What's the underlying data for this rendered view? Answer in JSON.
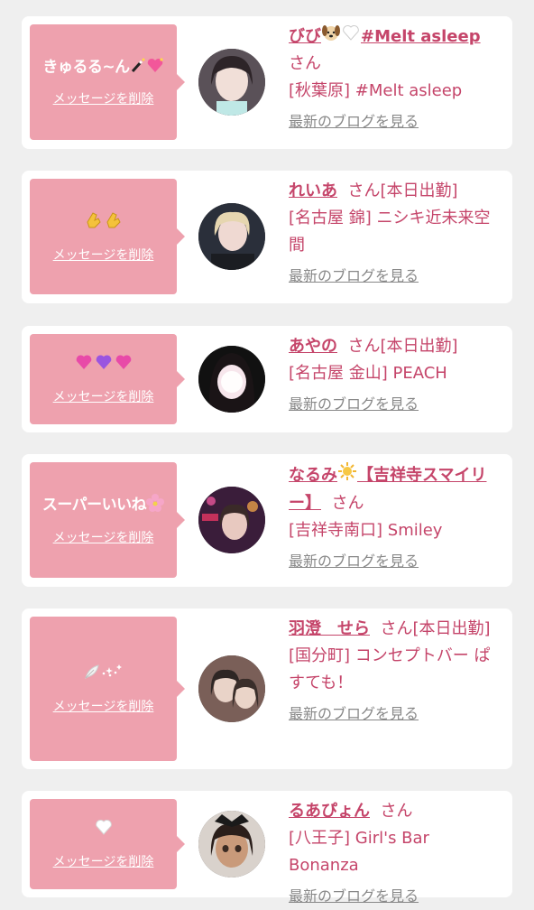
{
  "delete_label": "メッセージを削除",
  "blog_label": "最新のブログを見る",
  "san": "さん",
  "entries": [
    {
      "message": "きゅるる~ん",
      "message_icons": [
        "magic-wand-icon",
        "sparkling-heart-icon"
      ],
      "name": "びび",
      "name_icons": [
        "dog-face-icon",
        "white-heart-icon"
      ],
      "name_tail": "#Melt asleep",
      "status": "",
      "shop": "[秋葉原] #Melt asleep"
    },
    {
      "message": "",
      "message_icons": [
        "clapping-hands-icon",
        "clapping-hands-icon"
      ],
      "name": "れいあ",
      "name_icons": [],
      "name_tail": "",
      "status": "[本日出勤]",
      "shop": "[名古屋 錦] ニシキ近未来空間"
    },
    {
      "message": "",
      "message_icons": [
        "pink-heart-icon",
        "purple-heart-icon",
        "pink-heart-icon"
      ],
      "name": "あやの",
      "name_icons": [],
      "name_tail": "",
      "status": "[本日出勤]",
      "shop": "[名古屋 金山] PEACH"
    },
    {
      "message": "スーパーいいね",
      "message_icons": [
        "cherry-blossom-icon"
      ],
      "name": "なるみ",
      "name_icons": [
        "sun-icon"
      ],
      "name_tail": "【吉祥寺スマイリー】",
      "status": "",
      "shop": "[吉祥寺南口] Smiley"
    },
    {
      "message": "",
      "message_icons": [
        "feather-icon",
        "sparkle-dots-icon"
      ],
      "name": "羽澄　せら",
      "name_icons": [],
      "name_tail": "",
      "status": "[本日出勤]",
      "shop": "[国分町] コンセプトバー ぱすても！"
    },
    {
      "message": "",
      "message_icons": [
        "white-heart-icon"
      ],
      "name": "るあぴょん",
      "name_icons": [],
      "name_tail": "",
      "status": "",
      "shop": "[八王子] Girl's Bar Bonanza"
    }
  ],
  "colors": {
    "background": "#efefef",
    "card": "#ffffff",
    "bubble": "#eea1ae",
    "accent": "#c5456a",
    "link_gray": "#888888"
  }
}
